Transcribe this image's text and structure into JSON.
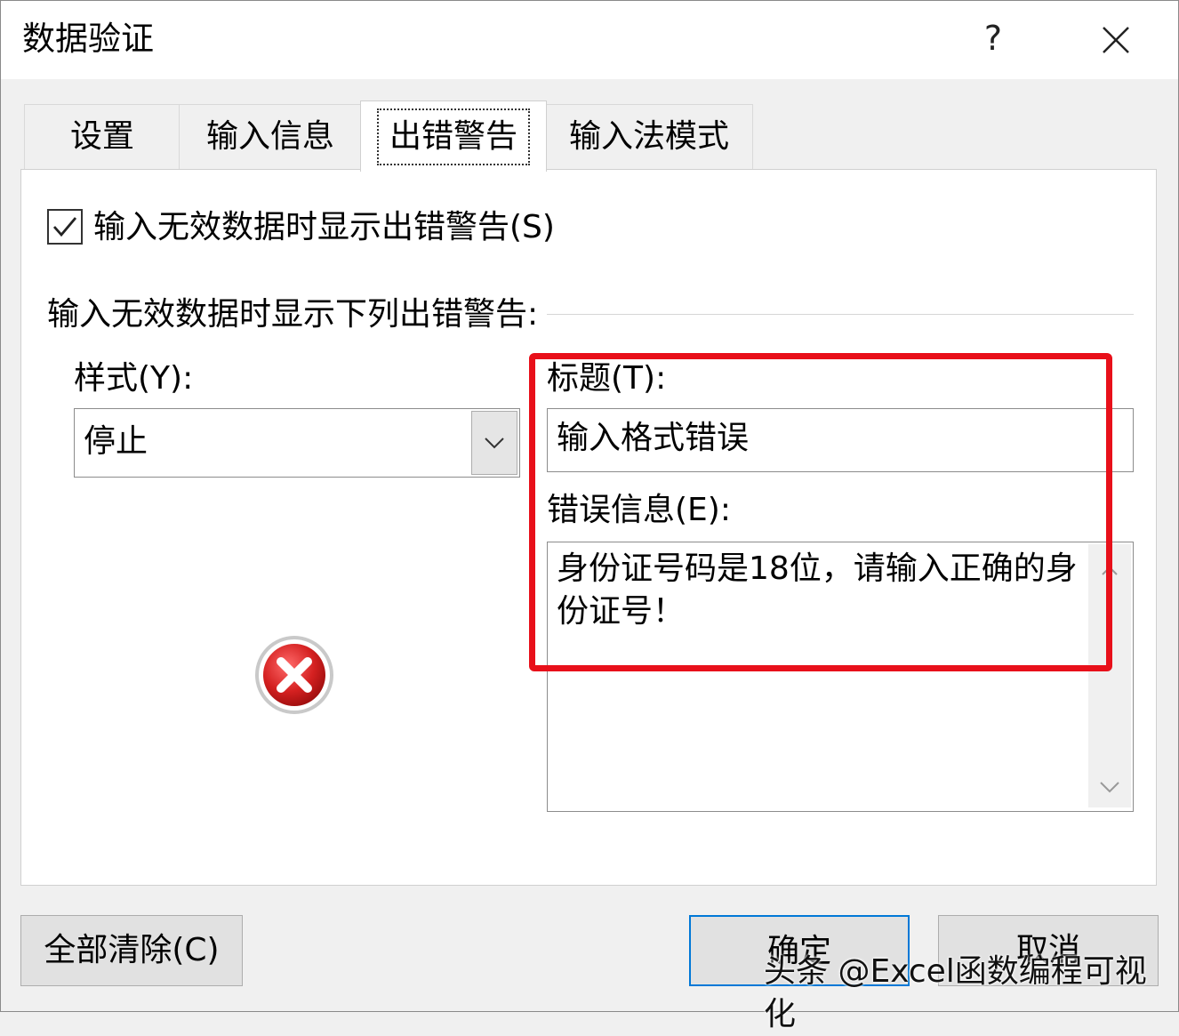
{
  "dialog": {
    "title": "数据验证",
    "help_label": "?",
    "close_icon": "close-icon"
  },
  "tabs": [
    {
      "label": "设置",
      "active": false
    },
    {
      "label": "输入信息",
      "active": false
    },
    {
      "label": "出错警告",
      "active": true
    },
    {
      "label": "输入法模式",
      "active": false
    }
  ],
  "error_alert": {
    "show_checkbox_label": "输入无效数据时显示出错警告(S)",
    "show_checked": true,
    "group_label": "输入无效数据时显示下列出错警告:",
    "style_label": "样式(Y):",
    "style_value": "停止",
    "style_icon": "error-stop-icon",
    "title_label": "标题(T):",
    "title_value": "输入格式错误",
    "message_label": "错误信息(E):",
    "message_value": "身份证号码是18位，请输入正确的身份证号！"
  },
  "buttons": {
    "clear_all": "全部清除(C)",
    "ok": "确定",
    "cancel": "取消"
  },
  "watermark": "头条 @Excel函数编程可视化",
  "colors": {
    "highlight": "#e8101a",
    "default_button_border": "#0078d7",
    "stop_icon_red": "#d42020"
  }
}
